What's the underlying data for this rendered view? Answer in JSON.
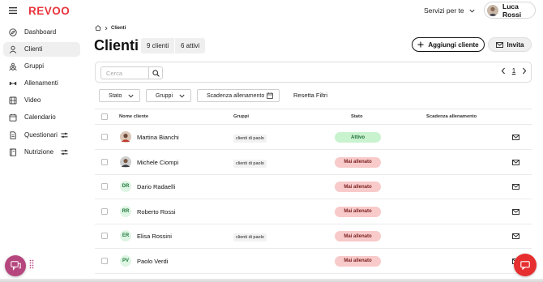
{
  "app": {
    "logo": "REVOO",
    "brand_color": "#e8343c"
  },
  "header": {
    "services_label": "Servizi per te",
    "user_name": "Luca Rossi"
  },
  "sidebar": {
    "items": [
      {
        "label": "Dashboard",
        "icon": "compass-icon",
        "active": false
      },
      {
        "label": "Clienti",
        "icon": "user-icon",
        "active": true
      },
      {
        "label": "Gruppi",
        "icon": "group-icon",
        "active": false
      },
      {
        "label": "Allenamenti",
        "icon": "dumbbell-icon",
        "active": false
      },
      {
        "label": "Video",
        "icon": "film-icon",
        "active": false
      },
      {
        "label": "Calendario",
        "icon": "calendar-icon",
        "active": false
      },
      {
        "label": "Questionari",
        "icon": "document-icon",
        "active": false,
        "extra_icon": "filter-lines-icon"
      },
      {
        "label": "Nutrizione",
        "icon": "book-icon",
        "active": false,
        "extra_icon": "filter-lines-icon"
      }
    ]
  },
  "breadcrumb": {
    "current": "Clienti"
  },
  "page": {
    "title": "Clienti",
    "count_total": "9 clienti",
    "count_active": "6 attivi",
    "add_button": "Aggiungi cliente",
    "invite_button": "Invita"
  },
  "search": {
    "placeholder": "Cerca",
    "value": ""
  },
  "pagination": {
    "current_page": "1"
  },
  "filters": {
    "status": "Stato",
    "groups": "Gruppi",
    "deadline": "Scadenza allenamento",
    "reset": "Resetta Filtri"
  },
  "table": {
    "columns": {
      "name": "Nome cliente",
      "groups": "Gruppi",
      "status": "Stato",
      "deadline": "Scadenza allenamento"
    },
    "rows": [
      {
        "name": "Martina Bianchi",
        "avatar": "photo",
        "initials": "",
        "group": "clienti di paolo",
        "status": "Attivo",
        "status_type": "active"
      },
      {
        "name": "Michele Ciompi",
        "avatar": "photo",
        "initials": "",
        "group": "clienti di paolo",
        "status": "Mai allenato",
        "status_type": "never"
      },
      {
        "name": "Dario Radaelli",
        "avatar": "initials",
        "initials": "DR",
        "group": "",
        "status": "Mai allenato",
        "status_type": "never"
      },
      {
        "name": "Roberto Rossi",
        "avatar": "initials",
        "initials": "RR",
        "group": "",
        "status": "Mai allenato",
        "status_type": "never"
      },
      {
        "name": "Elisa Rossini",
        "avatar": "initials",
        "initials": "ER",
        "group": "clienti di paolo",
        "status": "Mai allenato",
        "status_type": "never"
      },
      {
        "name": "Paolo Verdi",
        "avatar": "initials",
        "initials": "PV",
        "group": "",
        "status": "Mai allenato",
        "status_type": "never"
      }
    ]
  },
  "colors": {
    "active_bg": "#c9f2cf",
    "active_text": "#1f6b32",
    "never_bg": "#f8caca",
    "never_text": "#7a1e1e",
    "chat_left": "#b6467e",
    "chat_right": "#e62e2e"
  }
}
